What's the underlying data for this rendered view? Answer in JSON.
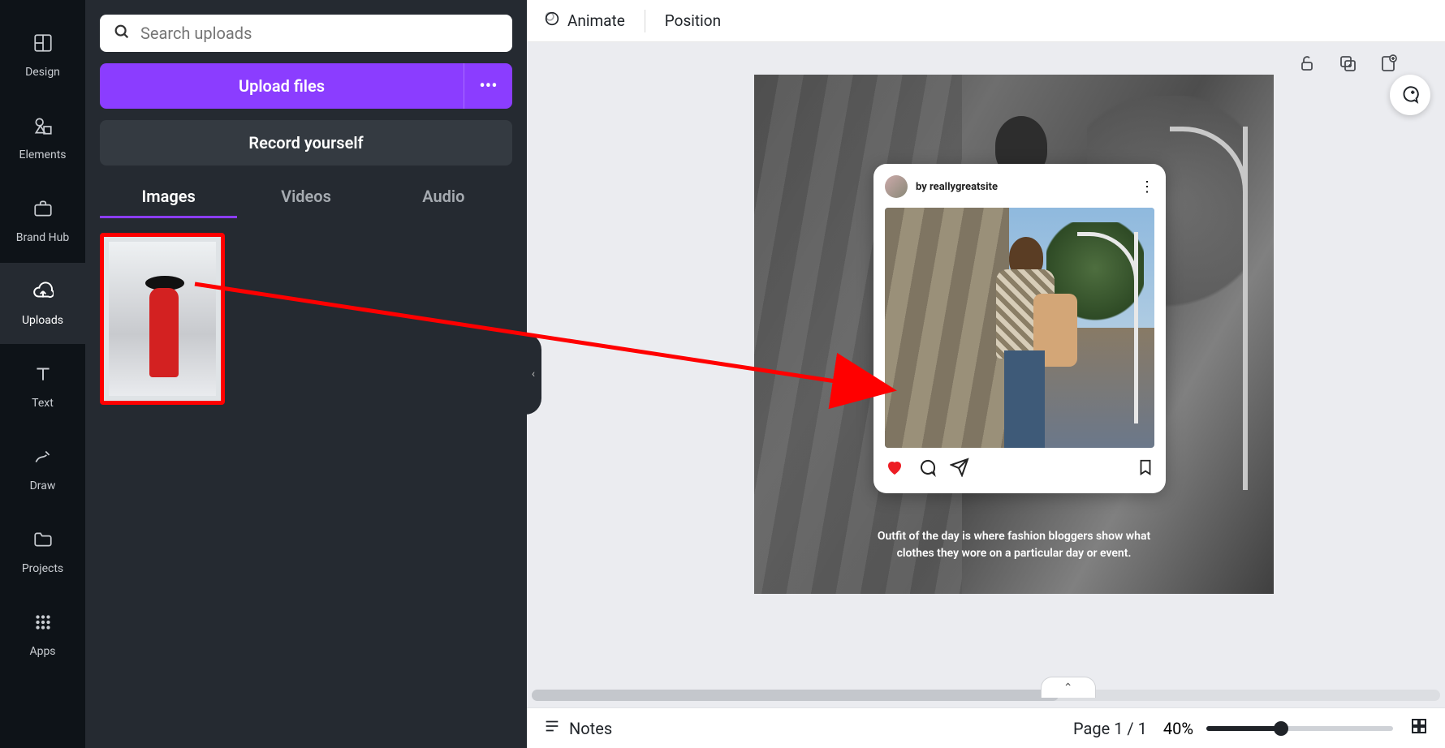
{
  "rail": {
    "items": [
      {
        "label": "Design"
      },
      {
        "label": "Elements"
      },
      {
        "label": "Brand Hub"
      },
      {
        "label": "Uploads"
      },
      {
        "label": "Text"
      },
      {
        "label": "Draw"
      },
      {
        "label": "Projects"
      },
      {
        "label": "Apps"
      }
    ]
  },
  "panel": {
    "search_placeholder": "Search uploads",
    "upload_label": "Upload files",
    "more_label": "•••",
    "record_label": "Record yourself",
    "tabs": [
      {
        "label": "Images"
      },
      {
        "label": "Videos"
      },
      {
        "label": "Audio"
      }
    ]
  },
  "toolbar": {
    "animate": "Animate",
    "position": "Position"
  },
  "ig": {
    "by_prefix": "by ",
    "author": "reallygreatsite"
  },
  "caption_line1": "Outfit of the day is where fashion bloggers show what",
  "caption_line2": "clothes they wore on a particular day or event.",
  "status": {
    "notes": "Notes",
    "page": "Page 1 / 1",
    "zoom": "40%"
  },
  "collapse_chevron": "‹",
  "expand_chevron": "⌃"
}
